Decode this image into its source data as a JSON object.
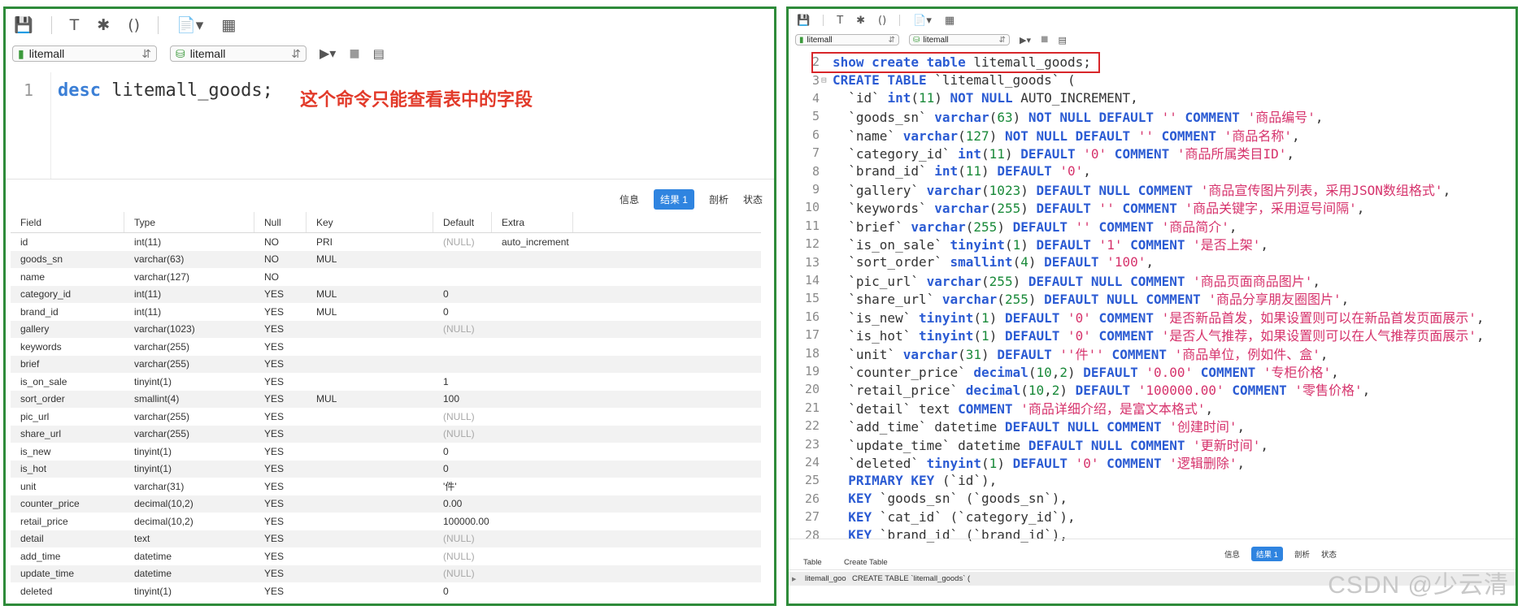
{
  "left": {
    "toolbar_icons": [
      "save-icon",
      "hammer-icon",
      "magic-wand-icon",
      "parentheses-icon",
      "document-icon",
      "export-icon"
    ],
    "conn_select": "litemall",
    "db_select": "litemall",
    "editor": {
      "line_number": "1",
      "keyword": "desc",
      "rest": " litemall_goods;"
    },
    "annotation": "这个命令只能查看表中的字段",
    "tabs": [
      "信息",
      "结果 1",
      "剖析",
      "状态"
    ],
    "grid": {
      "columns": [
        "Field",
        "Type",
        "Null",
        "Key",
        "Default",
        "Extra"
      ],
      "rows": [
        [
          "id",
          "int(11)",
          "NO",
          "PRI",
          "(NULL)",
          "auto_increment"
        ],
        [
          "goods_sn",
          "varchar(63)",
          "NO",
          "MUL",
          "",
          ""
        ],
        [
          "name",
          "varchar(127)",
          "NO",
          "",
          "",
          ""
        ],
        [
          "category_id",
          "int(11)",
          "YES",
          "MUL",
          "0",
          ""
        ],
        [
          "brand_id",
          "int(11)",
          "YES",
          "MUL",
          "0",
          ""
        ],
        [
          "gallery",
          "varchar(1023)",
          "YES",
          "",
          "(NULL)",
          ""
        ],
        [
          "keywords",
          "varchar(255)",
          "YES",
          "",
          "",
          ""
        ],
        [
          "brief",
          "varchar(255)",
          "YES",
          "",
          "",
          ""
        ],
        [
          "is_on_sale",
          "tinyint(1)",
          "YES",
          "",
          "1",
          ""
        ],
        [
          "sort_order",
          "smallint(4)",
          "YES",
          "MUL",
          "100",
          ""
        ],
        [
          "pic_url",
          "varchar(255)",
          "YES",
          "",
          "(NULL)",
          ""
        ],
        [
          "share_url",
          "varchar(255)",
          "YES",
          "",
          "(NULL)",
          ""
        ],
        [
          "is_new",
          "tinyint(1)",
          "YES",
          "",
          "0",
          ""
        ],
        [
          "is_hot",
          "tinyint(1)",
          "YES",
          "",
          "0",
          ""
        ],
        [
          "unit",
          "varchar(31)",
          "YES",
          "",
          "'件'",
          ""
        ],
        [
          "counter_price",
          "decimal(10,2)",
          "YES",
          "",
          "0.00",
          ""
        ],
        [
          "retail_price",
          "decimal(10,2)",
          "YES",
          "",
          "100000.00",
          ""
        ],
        [
          "detail",
          "text",
          "YES",
          "",
          "(NULL)",
          ""
        ],
        [
          "add_time",
          "datetime",
          "YES",
          "",
          "(NULL)",
          ""
        ],
        [
          "update_time",
          "datetime",
          "YES",
          "",
          "(NULL)",
          ""
        ],
        [
          "deleted",
          "tinyint(1)",
          "YES",
          "",
          "0",
          ""
        ]
      ]
    }
  },
  "right": {
    "conn_select": "litemall",
    "db_select": "litemall",
    "lines": [
      {
        "n": "2",
        "fold": "",
        "parts": [
          [
            "k",
            "show create table"
          ],
          [
            "x",
            " litemall_goods;"
          ]
        ]
      },
      {
        "n": "3",
        "fold": "⊟",
        "parts": [
          [
            "k",
            "CREATE TABLE"
          ],
          [
            "x",
            " `litemall_goods` ("
          ]
        ]
      },
      {
        "n": "4",
        "fold": "",
        "parts": [
          [
            "x",
            "  `id` "
          ],
          [
            "t",
            "int"
          ],
          [
            "x",
            "("
          ],
          [
            "n",
            "11"
          ],
          [
            "x",
            ") "
          ],
          [
            "k",
            "NOT NULL"
          ],
          [
            "x",
            " AUTO_INCREMENT,"
          ]
        ]
      },
      {
        "n": "5",
        "fold": "",
        "parts": [
          [
            "x",
            "  `goods_sn` "
          ],
          [
            "t",
            "varchar"
          ],
          [
            "x",
            "("
          ],
          [
            "n",
            "63"
          ],
          [
            "x",
            ") "
          ],
          [
            "k",
            "NOT NULL DEFAULT"
          ],
          [
            "s",
            " ''"
          ],
          [
            "k",
            " COMMENT"
          ],
          [
            "s",
            " '商品编号'"
          ],
          [
            "x",
            ","
          ]
        ]
      },
      {
        "n": "6",
        "fold": "",
        "parts": [
          [
            "x",
            "  `name` "
          ],
          [
            "t",
            "varchar"
          ],
          [
            "x",
            "("
          ],
          [
            "n",
            "127"
          ],
          [
            "x",
            ") "
          ],
          [
            "k",
            "NOT NULL DEFAULT"
          ],
          [
            "s",
            " ''"
          ],
          [
            "k",
            " COMMENT"
          ],
          [
            "s",
            " '商品名称'"
          ],
          [
            "x",
            ","
          ]
        ]
      },
      {
        "n": "7",
        "fold": "",
        "parts": [
          [
            "x",
            "  `category_id` "
          ],
          [
            "t",
            "int"
          ],
          [
            "x",
            "("
          ],
          [
            "n",
            "11"
          ],
          [
            "x",
            ") "
          ],
          [
            "k",
            "DEFAULT"
          ],
          [
            "s",
            " '0'"
          ],
          [
            "k",
            " COMMENT"
          ],
          [
            "s",
            " '商品所属类目ID'"
          ],
          [
            "x",
            ","
          ]
        ]
      },
      {
        "n": "8",
        "fold": "",
        "parts": [
          [
            "x",
            "  `brand_id` "
          ],
          [
            "t",
            "int"
          ],
          [
            "x",
            "("
          ],
          [
            "n",
            "11"
          ],
          [
            "x",
            ") "
          ],
          [
            "k",
            "DEFAULT"
          ],
          [
            "s",
            " '0'"
          ],
          [
            "x",
            ","
          ]
        ]
      },
      {
        "n": "9",
        "fold": "",
        "parts": [
          [
            "x",
            "  `gallery` "
          ],
          [
            "t",
            "varchar"
          ],
          [
            "x",
            "("
          ],
          [
            "n",
            "1023"
          ],
          [
            "x",
            ") "
          ],
          [
            "k",
            "DEFAULT NULL COMMENT"
          ],
          [
            "s",
            " '商品宣传图片列表，采用JSON数组格式'"
          ],
          [
            "x",
            ","
          ]
        ]
      },
      {
        "n": "10",
        "fold": "",
        "parts": [
          [
            "x",
            "  `keywords` "
          ],
          [
            "t",
            "varchar"
          ],
          [
            "x",
            "("
          ],
          [
            "n",
            "255"
          ],
          [
            "x",
            ") "
          ],
          [
            "k",
            "DEFAULT"
          ],
          [
            "s",
            " ''"
          ],
          [
            "k",
            " COMMENT"
          ],
          [
            "s",
            " '商品关键字，采用逗号间隔'"
          ],
          [
            "x",
            ","
          ]
        ]
      },
      {
        "n": "11",
        "fold": "",
        "parts": [
          [
            "x",
            "  `brief` "
          ],
          [
            "t",
            "varchar"
          ],
          [
            "x",
            "("
          ],
          [
            "n",
            "255"
          ],
          [
            "x",
            ") "
          ],
          [
            "k",
            "DEFAULT"
          ],
          [
            "s",
            " ''"
          ],
          [
            "k",
            " COMMENT"
          ],
          [
            "s",
            " '商品简介'"
          ],
          [
            "x",
            ","
          ]
        ]
      },
      {
        "n": "12",
        "fold": "",
        "parts": [
          [
            "x",
            "  `is_on_sale` "
          ],
          [
            "t",
            "tinyint"
          ],
          [
            "x",
            "("
          ],
          [
            "n",
            "1"
          ],
          [
            "x",
            ") "
          ],
          [
            "k",
            "DEFAULT"
          ],
          [
            "s",
            " '1'"
          ],
          [
            "k",
            " COMMENT"
          ],
          [
            "s",
            " '是否上架'"
          ],
          [
            "x",
            ","
          ]
        ]
      },
      {
        "n": "13",
        "fold": "",
        "parts": [
          [
            "x",
            "  `sort_order` "
          ],
          [
            "t",
            "smallint"
          ],
          [
            "x",
            "("
          ],
          [
            "n",
            "4"
          ],
          [
            "x",
            ") "
          ],
          [
            "k",
            "DEFAULT"
          ],
          [
            "s",
            " '100'"
          ],
          [
            "x",
            ","
          ]
        ]
      },
      {
        "n": "14",
        "fold": "",
        "parts": [
          [
            "x",
            "  `pic_url` "
          ],
          [
            "t",
            "varchar"
          ],
          [
            "x",
            "("
          ],
          [
            "n",
            "255"
          ],
          [
            "x",
            ") "
          ],
          [
            "k",
            "DEFAULT NULL COMMENT"
          ],
          [
            "s",
            " '商品页面商品图片'"
          ],
          [
            "x",
            ","
          ]
        ]
      },
      {
        "n": "15",
        "fold": "",
        "parts": [
          [
            "x",
            "  `share_url` "
          ],
          [
            "t",
            "varchar"
          ],
          [
            "x",
            "("
          ],
          [
            "n",
            "255"
          ],
          [
            "x",
            ") "
          ],
          [
            "k",
            "DEFAULT NULL COMMENT"
          ],
          [
            "s",
            " '商品分享朋友圈图片'"
          ],
          [
            "x",
            ","
          ]
        ]
      },
      {
        "n": "16",
        "fold": "",
        "parts": [
          [
            "x",
            "  `is_new` "
          ],
          [
            "t",
            "tinyint"
          ],
          [
            "x",
            "("
          ],
          [
            "n",
            "1"
          ],
          [
            "x",
            ") "
          ],
          [
            "k",
            "DEFAULT"
          ],
          [
            "s",
            " '0'"
          ],
          [
            "k",
            " COMMENT"
          ],
          [
            "s",
            " '是否新品首发，如果设置则可以在新品首发页面展示'"
          ],
          [
            "x",
            ","
          ]
        ]
      },
      {
        "n": "17",
        "fold": "",
        "parts": [
          [
            "x",
            "  `is_hot` "
          ],
          [
            "t",
            "tinyint"
          ],
          [
            "x",
            "("
          ],
          [
            "n",
            "1"
          ],
          [
            "x",
            ") "
          ],
          [
            "k",
            "DEFAULT"
          ],
          [
            "s",
            " '0'"
          ],
          [
            "k",
            " COMMENT"
          ],
          [
            "s",
            " '是否人气推荐，如果设置则可以在人气推荐页面展示'"
          ],
          [
            "x",
            ","
          ]
        ]
      },
      {
        "n": "18",
        "fold": "",
        "parts": [
          [
            "x",
            "  `unit` "
          ],
          [
            "t",
            "varchar"
          ],
          [
            "x",
            "("
          ],
          [
            "n",
            "31"
          ],
          [
            "x",
            ") "
          ],
          [
            "k",
            "DEFAULT"
          ],
          [
            "s",
            " ''件''"
          ],
          [
            "k",
            " COMMENT"
          ],
          [
            "s",
            " '商品单位，例如件、盒'"
          ],
          [
            "x",
            ","
          ]
        ]
      },
      {
        "n": "19",
        "fold": "",
        "parts": [
          [
            "x",
            "  `counter_price` "
          ],
          [
            "t",
            "decimal"
          ],
          [
            "x",
            "("
          ],
          [
            "n",
            "10"
          ],
          [
            "x",
            ","
          ],
          [
            "n",
            "2"
          ],
          [
            "x",
            ") "
          ],
          [
            "k",
            "DEFAULT"
          ],
          [
            "s",
            " '0.00'"
          ],
          [
            "k",
            " COMMENT"
          ],
          [
            "s",
            " '专柜价格'"
          ],
          [
            "x",
            ","
          ]
        ]
      },
      {
        "n": "20",
        "fold": "",
        "parts": [
          [
            "x",
            "  `retail_price` "
          ],
          [
            "t",
            "decimal"
          ],
          [
            "x",
            "("
          ],
          [
            "n",
            "10"
          ],
          [
            "x",
            ","
          ],
          [
            "n",
            "2"
          ],
          [
            "x",
            ") "
          ],
          [
            "k",
            "DEFAULT"
          ],
          [
            "s",
            " '100000.00'"
          ],
          [
            "k",
            " COMMENT"
          ],
          [
            "s",
            " '零售价格'"
          ],
          [
            "x",
            ","
          ]
        ]
      },
      {
        "n": "21",
        "fold": "",
        "parts": [
          [
            "x",
            "  `detail` text "
          ],
          [
            "k",
            "COMMENT"
          ],
          [
            "s",
            " '商品详细介绍，是富文本格式'"
          ],
          [
            "x",
            ","
          ]
        ]
      },
      {
        "n": "22",
        "fold": "",
        "parts": [
          [
            "x",
            "  `add_time` datetime "
          ],
          [
            "k",
            "DEFAULT NULL COMMENT"
          ],
          [
            "s",
            " '创建时间'"
          ],
          [
            "x",
            ","
          ]
        ]
      },
      {
        "n": "23",
        "fold": "",
        "parts": [
          [
            "x",
            "  `update_time` datetime "
          ],
          [
            "k",
            "DEFAULT NULL COMMENT"
          ],
          [
            "s",
            " '更新时间'"
          ],
          [
            "x",
            ","
          ]
        ]
      },
      {
        "n": "24",
        "fold": "",
        "parts": [
          [
            "x",
            "  `deleted` "
          ],
          [
            "t",
            "tinyint"
          ],
          [
            "x",
            "("
          ],
          [
            "n",
            "1"
          ],
          [
            "x",
            ") "
          ],
          [
            "k",
            "DEFAULT"
          ],
          [
            "s",
            " '0'"
          ],
          [
            "k",
            " COMMENT"
          ],
          [
            "s",
            " '逻辑删除'"
          ],
          [
            "x",
            ","
          ]
        ]
      },
      {
        "n": "25",
        "fold": "",
        "parts": [
          [
            "k",
            "  PRIMARY KEY"
          ],
          [
            "x",
            " (`id`),"
          ]
        ]
      },
      {
        "n": "26",
        "fold": "",
        "parts": [
          [
            "k",
            "  KEY"
          ],
          [
            "x",
            " `goods_sn` (`goods_sn`),"
          ]
        ]
      },
      {
        "n": "27",
        "fold": "",
        "parts": [
          [
            "k",
            "  KEY"
          ],
          [
            "x",
            " `cat_id` (`category_id`),"
          ]
        ]
      },
      {
        "n": "28",
        "fold": "",
        "parts": [
          [
            "k",
            "  KEY"
          ],
          [
            "x",
            " `brand_id` (`brand_id`),"
          ]
        ]
      }
    ],
    "tabs": [
      "信息",
      "结果 1",
      "剖析",
      "状态"
    ],
    "result": {
      "headers": [
        "Table",
        "Create Table"
      ],
      "row": [
        "litemall_goo",
        "CREATE TABLE `litemall_goods` ("
      ]
    }
  },
  "watermark": "CSDN @少云清"
}
